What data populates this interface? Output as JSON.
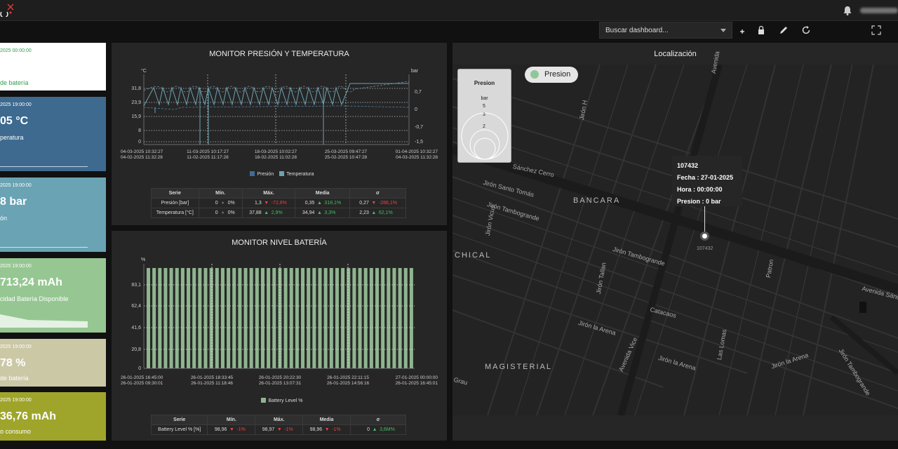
{
  "header": {
    "search_placeholder": "Buscar dashboard...",
    "icons": [
      "bell-icon",
      "add-icon",
      "lock-icon",
      "edit-icon",
      "refresh-icon",
      "fullscreen-icon"
    ]
  },
  "cards": [
    {
      "ts": "2025 00:00:00",
      "value": "",
      "label": "de batería",
      "bg": "#ffffff",
      "ts_color": "#2e9e4f",
      "label_color": "#2e9e4f"
    },
    {
      "ts": "2025 19:00:00",
      "value": "05 °C",
      "label": "peratura",
      "bg": "#3e6a8f"
    },
    {
      "ts": "2025 19:00:00",
      "value": "8 bar",
      "label": "ón",
      "bg": "#6aa3b3"
    },
    {
      "ts": "2025 19:00:00",
      "value": "713,24 mAh",
      "label": "cidad Batería Disponible",
      "bg": "#96c792"
    },
    {
      "ts": "2025 19:00:00",
      "value": "78 %",
      "label": "de batería",
      "bg": "#cbc8a6"
    },
    {
      "ts": "2025 19:00:00",
      "value": "36,76 mAh",
      "label": "o consumo",
      "bg": "#9fa52b"
    }
  ],
  "panel1": {
    "title": "MONITOR PRESIÓN Y TEMPERATURA",
    "left_unit": "°C",
    "right_unit": "bar",
    "left_ticks": [
      "31,8",
      "23,9",
      "15,9",
      "8",
      "0"
    ],
    "right_ticks": [
      "0,7",
      "0",
      "-0,7",
      "-1,5"
    ],
    "x_ticks": [
      {
        "top": "04-03-2025 10:32:27",
        "bottom": "04-02-2025 11:32:28"
      },
      {
        "top": "11-03-2025 10:17:27",
        "bottom": "11-02-2025 11:17:28"
      },
      {
        "top": "18-03-2025 10:02:27",
        "bottom": "18-02-2025 11:02:28"
      },
      {
        "top": "25-03-2025 09:47:27",
        "bottom": "25-02-2025 10:47:28"
      },
      {
        "top": "01-04-2025 10:32:27",
        "bottom": "04-03-2025 11:32:28"
      }
    ],
    "legend": [
      {
        "name": "Presión",
        "color": "#3d6d98"
      },
      {
        "name": "Temperatura",
        "color": "#6aa3b3"
      }
    ],
    "table": {
      "headers": [
        "Serie",
        "Mín.",
        "Máx.",
        "Media",
        "σ"
      ],
      "rows": [
        {
          "serie": "Presión [bar]",
          "min": "0",
          "min_pct": "0%",
          "max": "1,3",
          "max_pct": "-72,6%",
          "max_dir": "down",
          "mean": "0,35",
          "mean_pct": "318,1%",
          "mean_dir": "up",
          "sd": "0,27",
          "sd_pct": "-286,1%",
          "sd_dir": "down"
        },
        {
          "serie": "Temperatura [°C]",
          "min": "0",
          "min_pct": "0%",
          "max": "37,88",
          "max_pct": "2,9%",
          "max_dir": "up",
          "mean": "34,94",
          "mean_pct": "3,3%",
          "mean_dir": "up",
          "sd": "2,23",
          "sd_pct": "62,1%",
          "sd_dir": "up"
        }
      ]
    }
  },
  "panel2": {
    "title": "MONITOR NIVEL BATERÍA",
    "unit": "%",
    "y_ticks": [
      "83,1",
      "62,4",
      "41,6",
      "20,8",
      "0"
    ],
    "x_ticks": [
      {
        "top": "26-01-2025 16:45:00",
        "bottom": "26-01-2025 09:30:01"
      },
      {
        "top": "26-01-2025 18:33:45",
        "bottom": "26-01-2025 11:18:46"
      },
      {
        "top": "26-01-2025 20:22:30",
        "bottom": "26-01-2025 13:07:31"
      },
      {
        "top": "26-01-2025 22:11:15",
        "bottom": "26-01-2025 14:56:16"
      },
      {
        "top": "27-01-2025 00:00:00",
        "bottom": "26-01-2025 16:45:01"
      }
    ],
    "legend": [
      {
        "name": "Battery Level %",
        "color": "#8fb58f"
      }
    ],
    "table": {
      "headers": [
        "Serie",
        "Mín.",
        "Máx.",
        "Media",
        "σ"
      ],
      "rows": [
        {
          "serie": "Battery Level % [%]",
          "min": "98,96",
          "min_pct": "-1%",
          "min_dir": "down",
          "max": "98,97",
          "max_pct": "-1%",
          "max_dir": "down",
          "mean": "98,96",
          "mean_pct": "-1%",
          "mean_dir": "down",
          "sd": "0",
          "sd_pct": "3,6M%",
          "sd_dir": "up"
        }
      ]
    }
  },
  "map": {
    "title": "Localización",
    "layer": "Presion",
    "legend_title": "Presion",
    "legend_unit": "bar",
    "legend_values": [
      "5",
      "3",
      "2"
    ],
    "popup": {
      "id": "107432",
      "fecha": "Fecha : 27-01-2025",
      "hora": "Hora : 00:00:00",
      "presion": "Presion : 0 bar"
    },
    "marker_label": "107432",
    "streets": [
      {
        "name": "Avenida",
        "x": 1012,
        "y": 104,
        "rot": -80
      },
      {
        "name": "Jirón H",
        "x": 824,
        "y": 170,
        "rot": -80
      },
      {
        "name": "Sánchez Cerro",
        "x": 732,
        "y": 232,
        "rot": 12
      },
      {
        "name": "Jirón Santo Tomás",
        "x": 690,
        "y": 255,
        "rot": 14
      },
      {
        "name": "Jirón Tambogrande",
        "x": 696,
        "y": 286,
        "rot": 16
      },
      {
        "name": "Jirón Vicus",
        "x": 690,
        "y": 335,
        "rot": -80
      },
      {
        "name": "Jirón Tambogrande",
        "x": 875,
        "y": 350,
        "rot": 16
      },
      {
        "name": "Jirón Tallan",
        "x": 848,
        "y": 418,
        "rot": -80
      },
      {
        "name": "Patron",
        "x": 1090,
        "y": 395,
        "rot": -80
      },
      {
        "name": "Avenida Sánc",
        "x": 1230,
        "y": 406,
        "rot": 14
      },
      {
        "name": "Catacaos",
        "x": 928,
        "y": 436,
        "rot": 14
      },
      {
        "name": "Jirón la Arena",
        "x": 826,
        "y": 455,
        "rot": 16
      },
      {
        "name": "Las Lomas",
        "x": 1020,
        "y": 512,
        "rot": -80
      },
      {
        "name": "Jirón Tambogrande",
        "x": 1202,
        "y": 495,
        "rot": 58
      },
      {
        "name": "Jirón la Arena",
        "x": 1098,
        "y": 518,
        "rot": -18
      },
      {
        "name": "Avenida Vice",
        "x": 880,
        "y": 527,
        "rot": -66
      },
      {
        "name": "Jirón la Arena",
        "x": 940,
        "y": 505,
        "rot": 16
      },
      {
        "name": "Grau",
        "x": 648,
        "y": 536,
        "rot": 14
      }
    ],
    "neighborhoods": [
      {
        "name": "BANCARA",
        "x": 817,
        "y": 280
      },
      {
        "name": "CHICAL",
        "x": 648,
        "y": 358
      },
      {
        "name": "MAGISTERIAL",
        "x": 691,
        "y": 517
      }
    ]
  }
}
